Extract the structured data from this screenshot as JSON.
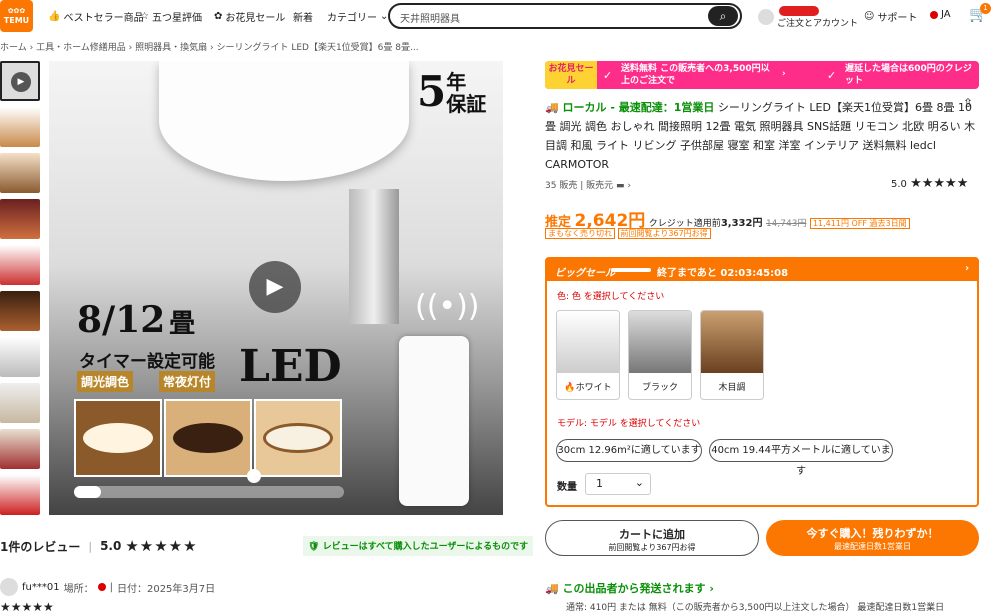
{
  "header": {
    "logo_text": "TEMU",
    "nav": [
      "ベストセラー商品",
      "五つ星評価",
      "お花見セール",
      "新着",
      "カテゴリー"
    ],
    "search_placeholder": "天井照明器具",
    "account": "ご注文とアカウント",
    "support": "サポート",
    "lang": "JA",
    "cart_count": "1"
  },
  "breadcrumb": [
    "ホーム",
    "工具・ホーム修繕用品",
    "照明器具・換気扇",
    "シーリングライト LED【楽天1位受賞】6畳 8畳..."
  ],
  "main_image": {
    "badge_num": "5",
    "badge_text1": "年",
    "badge_text2": "保証",
    "size_text": "8/12",
    "size_unit": "畳",
    "timer": "タイマー設定可能",
    "led": "LED",
    "tag1": "調光調色",
    "tag2": "常夜灯付"
  },
  "promo": {
    "label": "お花見セール",
    "msg1": "送料無料 この販売者への3,500円以上のご注文で",
    "msg2": "遅延した場合は600円のクレジット"
  },
  "product": {
    "local_tag": "ローカル - 最速配達：1営業日",
    "title": "シーリングライト LED【楽天1位受賞】6畳 8畳 10畳 調光 調色 おしゃれ 間接照明 12畳 電気 照明器具 SNS話題 リモコン 北欧 明るい 木目調 和風 ライト リビング 子供部屋 寝室 和室 洋室 インテリア 送料無料 ledcl CARMOTOR",
    "sold": "35 販売",
    "seller": "販売元",
    "rating": "5.0"
  },
  "price": {
    "label": "推定",
    "value": "2,642円",
    "credit": "クレジット適用前",
    "credit_price": "3,332円",
    "orig": "14,743円",
    "off": "11,411円 OFF 過去3日間",
    "tag1": "まもなく売り切れ",
    "tag2": "前回閲覧より367円お得"
  },
  "sale": {
    "label": "ビッグセール",
    "countdown_label": "終了まであと",
    "countdown": "02:03:45:08",
    "color_label": "色:",
    "color_hint": "色 を選択してください",
    "colors": [
      "ホワイト",
      "ブラック",
      "木目調"
    ],
    "model_label": "モデル:",
    "model_hint": "モデル を選択してください",
    "models": [
      "30cm 12.96m²に適しています",
      "40cm 19.44平方メートルに適しています"
    ],
    "qty_label": "数量",
    "qty": "1"
  },
  "buttons": {
    "cart": "カートに追加",
    "cart_sub": "前回閲覧より367円お得",
    "buy": "今すぐ購入！残りわずか！",
    "buy_sub": "最速配達日数1営業日"
  },
  "reviews": {
    "count": "1件のレビュー",
    "rating": "5.0",
    "verified": "レビューはすべて購入したユーザーによるものです",
    "user": "fu***01",
    "place": "場所：",
    "date": "日付：2025年3月7日"
  },
  "shipping": {
    "title": "この出品者から発送されます",
    "line": "通常: 410円 または 無料（この販売者から3,500円以上注文した場合） 最速配達日数1営業日"
  },
  "colors": {
    "accent": "#fb7701",
    "pink": "#ff2d8a",
    "green": "#0a8f08"
  }
}
